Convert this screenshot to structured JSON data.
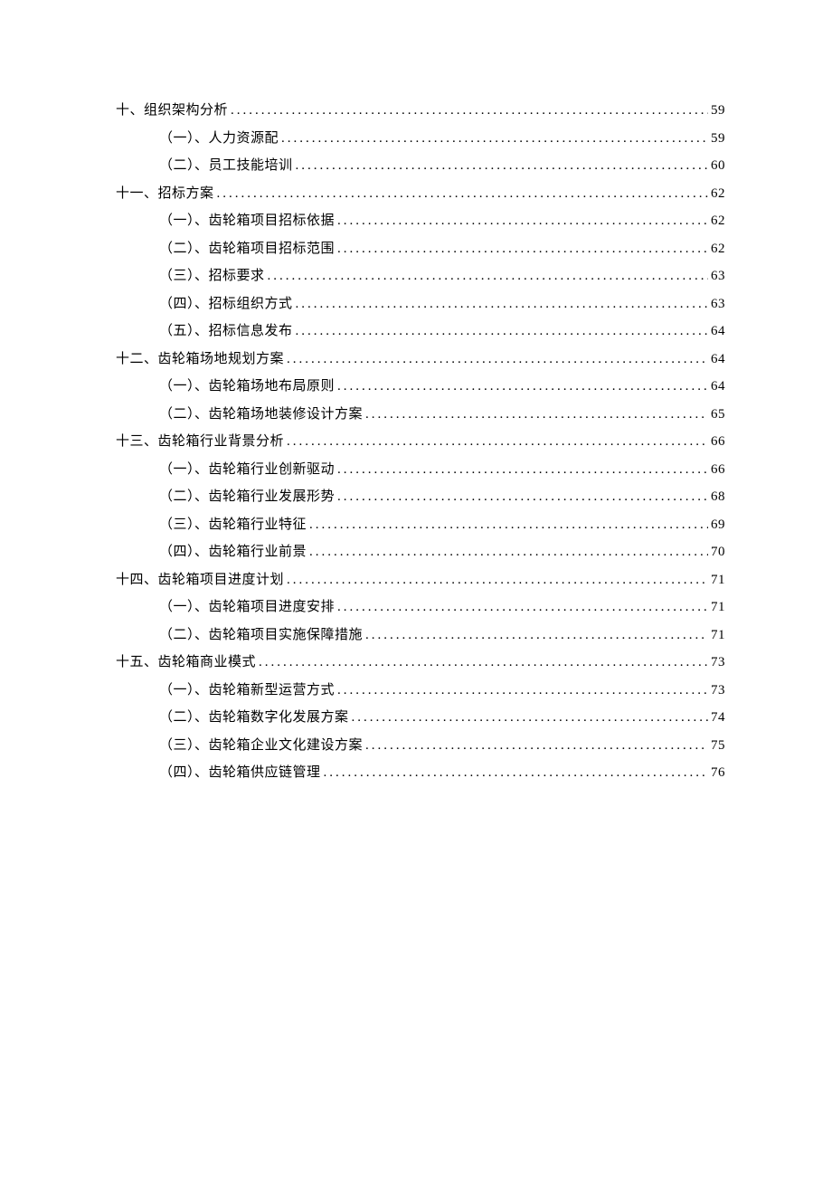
{
  "toc": [
    {
      "level": 1,
      "label": "十、组织架构分析",
      "page": "59"
    },
    {
      "level": 2,
      "label": "（一）、人力资源配",
      "page": "59"
    },
    {
      "level": 2,
      "label": "（二）、员工技能培训",
      "page": "60"
    },
    {
      "level": 1,
      "label": "十一、招标方案",
      "page": "62"
    },
    {
      "level": 2,
      "label": "（一）、齿轮箱项目招标依据",
      "page": "62"
    },
    {
      "level": 2,
      "label": "（二）、齿轮箱项目招标范围",
      "page": "62"
    },
    {
      "level": 2,
      "label": "（三）、招标要求",
      "page": "63"
    },
    {
      "level": 2,
      "label": "（四）、招标组织方式",
      "page": "63"
    },
    {
      "level": 2,
      "label": "（五）、招标信息发布",
      "page": "64"
    },
    {
      "level": 1,
      "label": "十二、齿轮箱场地规划方案",
      "page": "64"
    },
    {
      "level": 2,
      "label": "（一）、齿轮箱场地布局原则",
      "page": "64"
    },
    {
      "level": 2,
      "label": "（二）、齿轮箱场地装修设计方案",
      "page": "65"
    },
    {
      "level": 1,
      "label": "十三、齿轮箱行业背景分析",
      "page": "66"
    },
    {
      "level": 2,
      "label": "（一）、齿轮箱行业创新驱动",
      "page": "66"
    },
    {
      "level": 2,
      "label": "（二）、齿轮箱行业发展形势",
      "page": "68"
    },
    {
      "level": 2,
      "label": "（三）、齿轮箱行业特征",
      "page": "69"
    },
    {
      "level": 2,
      "label": "（四）、齿轮箱行业前景",
      "page": "70"
    },
    {
      "level": 1,
      "label": "十四、齿轮箱项目进度计划",
      "page": "71"
    },
    {
      "level": 2,
      "label": "（一）、齿轮箱项目进度安排",
      "page": "71"
    },
    {
      "level": 2,
      "label": "（二）、齿轮箱项目实施保障措施",
      "page": "71"
    },
    {
      "level": 1,
      "label": "十五、齿轮箱商业模式",
      "page": "73"
    },
    {
      "level": 2,
      "label": "（一）、齿轮箱新型运营方式",
      "page": "73"
    },
    {
      "level": 2,
      "label": "（二）、齿轮箱数字化发展方案",
      "page": "74"
    },
    {
      "level": 2,
      "label": "（三）、齿轮箱企业文化建设方案",
      "page": "75"
    },
    {
      "level": 2,
      "label": "（四）、齿轮箱供应链管理",
      "page": "76"
    }
  ]
}
